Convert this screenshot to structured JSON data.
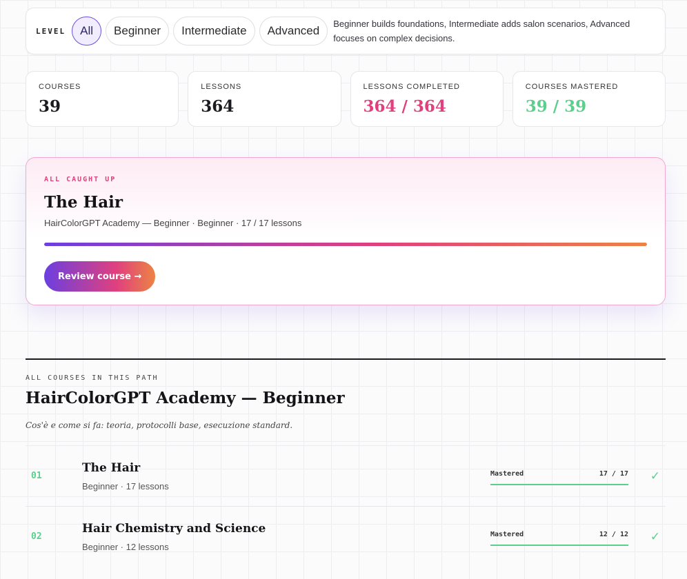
{
  "level_filter": {
    "label": "LEVEL",
    "options": [
      "All",
      "Beginner",
      "Intermediate",
      "Advanced"
    ],
    "selected": "All",
    "description": "Beginner builds foundations, Intermediate adds salon scenarios, Advanced focuses on complex decisions."
  },
  "stats": [
    {
      "label": "COURSES",
      "value": "39"
    },
    {
      "label": "LESSONS",
      "value": "364"
    },
    {
      "label": "LESSONS COMPLETED",
      "value": "364 / 364"
    },
    {
      "label": "COURSES MASTERED",
      "value": "39 / 39"
    }
  ],
  "colors": {
    "accent_pink": "#e0407e",
    "accent_green": "#5ccf8c",
    "accent_purple": "#6b3fe0",
    "accent_orange": "#ec8344"
  },
  "hero": {
    "eyebrow": "ALL CAUGHT UP",
    "title": "The Hair",
    "subtitle": "HairColorGPT Academy — Beginner · Beginner · 17 / 17 lessons",
    "progress": 1.0,
    "button_label": "Review course →"
  },
  "section": {
    "eyebrow": "ALL COURSES IN THIS PATH",
    "title": "HairColorGPT Academy — Beginner",
    "description": "Cos'è e come si fa: teoria, protocolli base, esecuzione standard.",
    "courses": [
      {
        "number": "01",
        "title": "The Hair",
        "meta": "Beginner · 17 lessons",
        "status": "Mastered",
        "count": "17 / 17",
        "progress": 1.0,
        "check": "✓"
      },
      {
        "number": "02",
        "title": "Hair Chemistry and Science",
        "meta": "Beginner · 12 lessons",
        "status": "Mastered",
        "count": "12 / 12",
        "progress": 1.0,
        "check": "✓"
      }
    ]
  }
}
